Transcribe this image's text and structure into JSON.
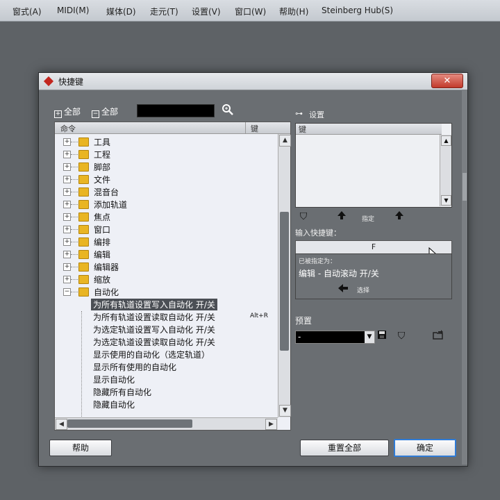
{
  "menubar": {
    "items": [
      "窗式(A)",
      "MIDI(M)",
      "媒体(D)",
      "走元(T)",
      "设置(V)",
      "窗口(W)",
      "帮助(H)",
      "Steinberg Hub(S)"
    ]
  },
  "dialog": {
    "title": "快捷键",
    "expand_all": "全部",
    "collapse_all": "全部",
    "column_command": "命令",
    "column_key": "键",
    "tree": [
      {
        "type": "folder",
        "label": "工具"
      },
      {
        "type": "folder",
        "label": "工程"
      },
      {
        "type": "folder",
        "label": "脚部"
      },
      {
        "type": "folder",
        "label": "文件"
      },
      {
        "type": "folder",
        "label": "混音台"
      },
      {
        "type": "folder",
        "label": "添加轨道"
      },
      {
        "type": "folder",
        "label": "焦点"
      },
      {
        "type": "folder",
        "label": "窗口"
      },
      {
        "type": "folder",
        "label": "编排"
      },
      {
        "type": "folder",
        "label": "编辑"
      },
      {
        "type": "folder",
        "label": "编辑器"
      },
      {
        "type": "folder",
        "label": "缩放"
      },
      {
        "type": "folder-open",
        "label": "自动化"
      },
      {
        "type": "leaf",
        "label": "为所有轨道设置写入自动化 开/关",
        "key": "",
        "selected": true
      },
      {
        "type": "leaf",
        "label": "为所有轨道设置读取自动化 开/关",
        "key": "Alt+R"
      },
      {
        "type": "leaf",
        "label": "为选定轨道设置写入自动化 开/关",
        "key": ""
      },
      {
        "type": "leaf",
        "label": "为选定轨道设置读取自动化 开/关",
        "key": ""
      },
      {
        "type": "leaf",
        "label": "显示使用的自动化（选定轨道）",
        "key": ""
      },
      {
        "type": "leaf",
        "label": "显示所有使用的自动化",
        "key": ""
      },
      {
        "type": "leaf",
        "label": "显示自动化",
        "key": ""
      },
      {
        "type": "leaf",
        "label": "隐藏所有自动化",
        "key": ""
      },
      {
        "type": "leaf",
        "label": "隐藏自动化",
        "key": ""
      }
    ],
    "right": {
      "settings_label": "设置",
      "keys_header": "键",
      "assign_label": "指定",
      "input_label": "输入快捷键：",
      "input_value": "F",
      "assigned_to_label": "已被指定为：",
      "assigned_to_value": "编辑 - 自动滚动 开/关",
      "goto_label": "选择",
      "presets_label": "预置",
      "preset_value": "-"
    },
    "buttons": {
      "help": "帮助",
      "reset_all": "重置全部",
      "ok": "确定"
    }
  }
}
